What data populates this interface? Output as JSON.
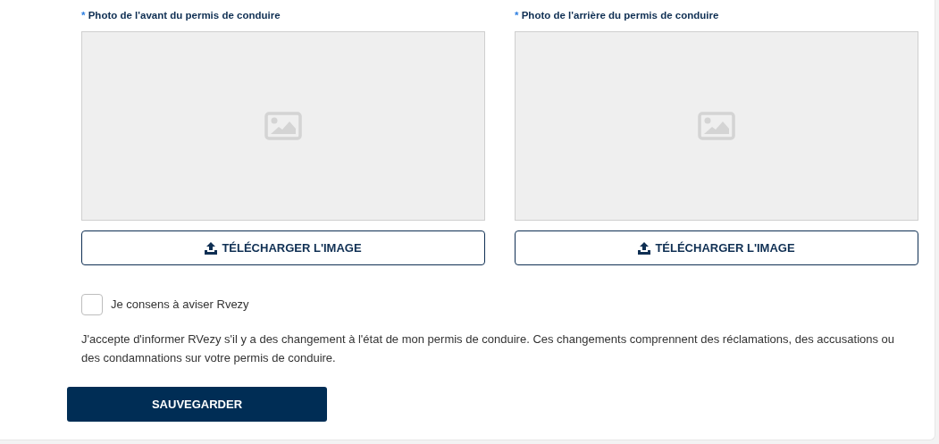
{
  "uploads": [
    {
      "required_mark": "*",
      "label": "Photo de l'avant du permis de conduire",
      "button": "TÉLÉCHARGER L'IMAGE"
    },
    {
      "required_mark": "*",
      "label": "Photo de l'arrière du permis de conduire",
      "button": "TÉLÉCHARGER L'IMAGE"
    }
  ],
  "consent": {
    "label": "Je consens à aviser Rvezy",
    "checked": false
  },
  "notice": "J'accepte d'informer RVezy s'il y a des changement à l'état de mon permis de conduire. Ces changements comprennent des réclamations, des accusations ou des condamnations sur votre permis de conduire.",
  "save_button": "SAUVEGARDER"
}
